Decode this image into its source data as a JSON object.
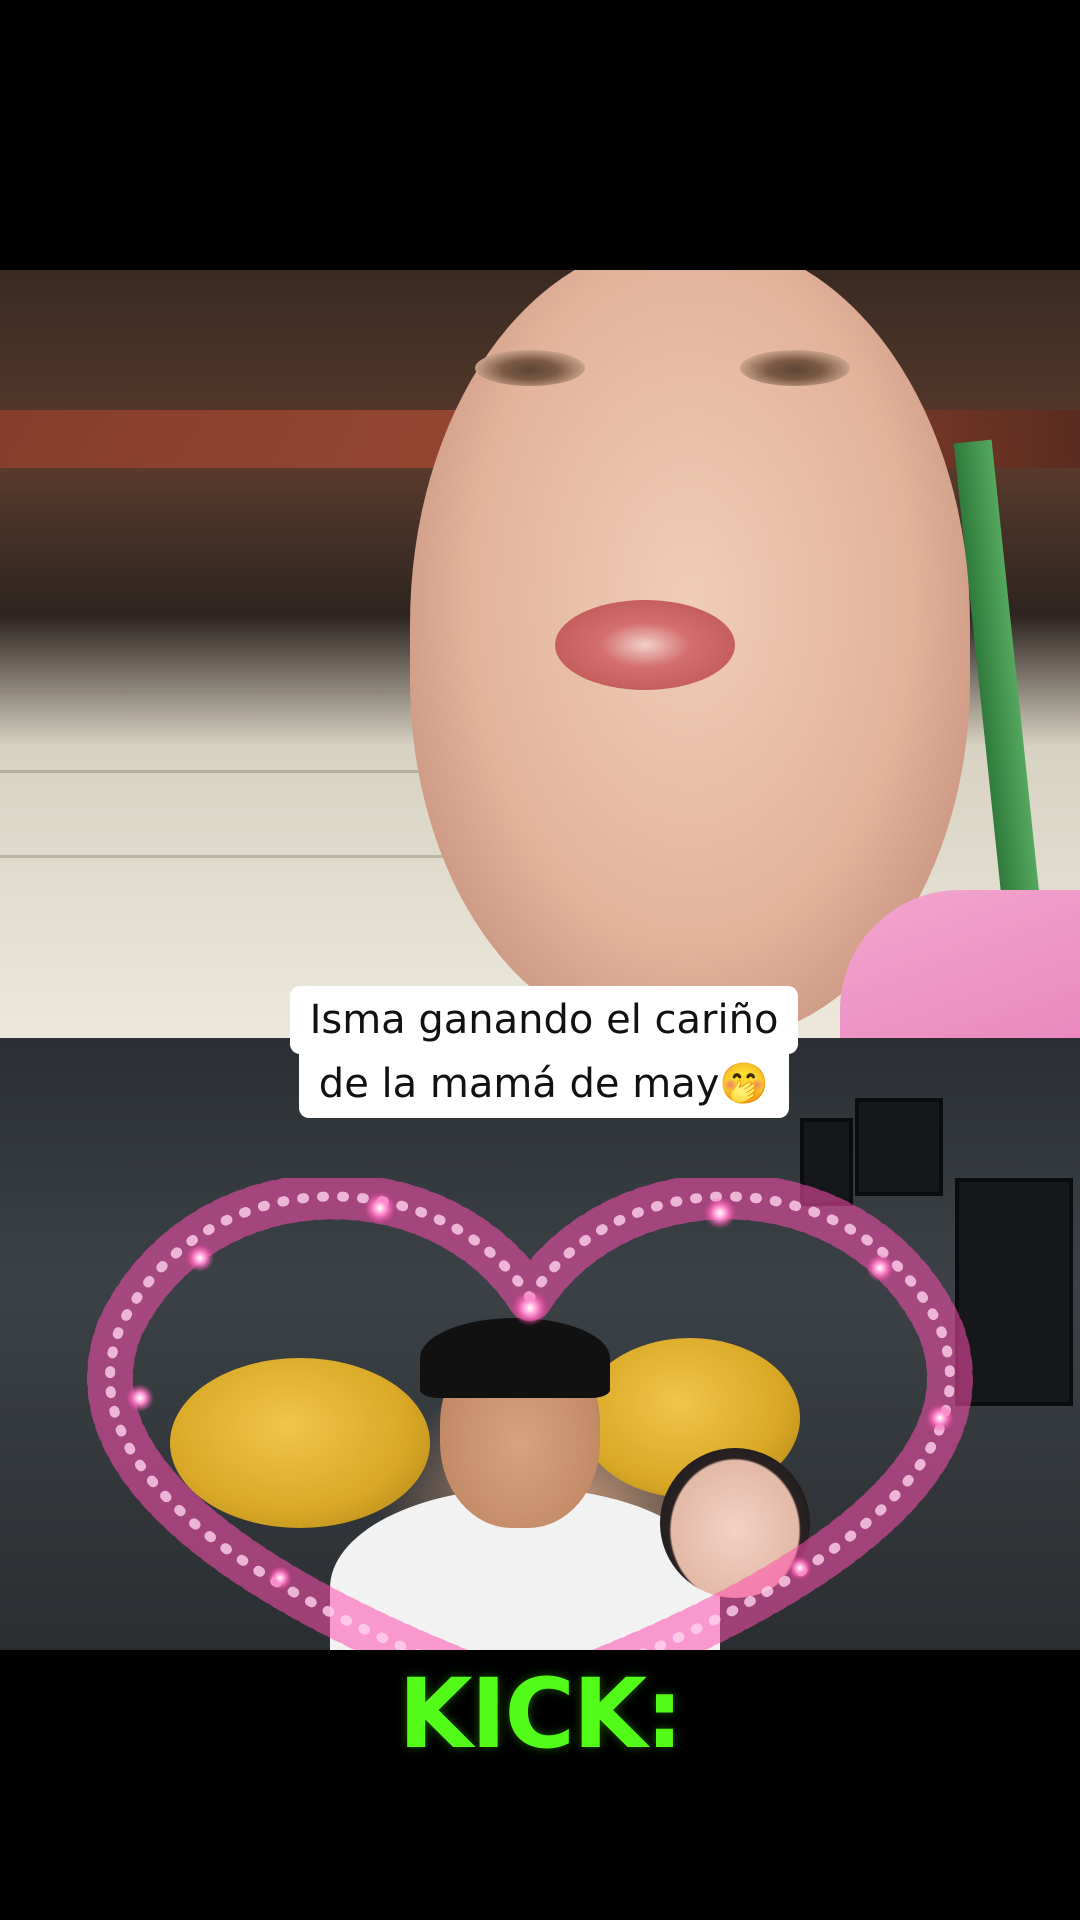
{
  "caption": {
    "line1": "Isma ganando el cariño",
    "line2": "de la mamá de may🤭"
  },
  "brand": {
    "logo_text": "KICK:",
    "logo_color": "#53fc18"
  },
  "colors": {
    "background": "#000000",
    "caption_background": "#ffffff",
    "caption_text": "#111111"
  }
}
